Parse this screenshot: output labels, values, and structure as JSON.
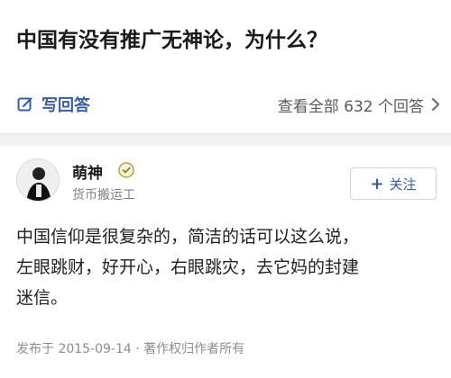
{
  "question": {
    "title": "中国有没有推广无神论，为什么？"
  },
  "actions": {
    "write_answer_label": "写回答",
    "view_all_label": "查看全部 632 个回答"
  },
  "answer": {
    "author_name": "萌神",
    "author_desc": "货币搬运工",
    "follow_label": "关注",
    "follow_plus": "+",
    "body_lines": [
      "中国信仰是很复杂的，简洁的话可以这么说，",
      "左眼跳财，好开心，右眼跳灾，去它妈的封建",
      "迷信。"
    ],
    "meta": "发布于 2015-09-14 · 著作权归作者所有"
  },
  "icons": {
    "write": "edit-icon",
    "chevron": "chevron-right-icon",
    "badge": "verified-badge-icon"
  },
  "colors": {
    "accent": "#3b5d9c",
    "muted": "#7c7f85"
  }
}
